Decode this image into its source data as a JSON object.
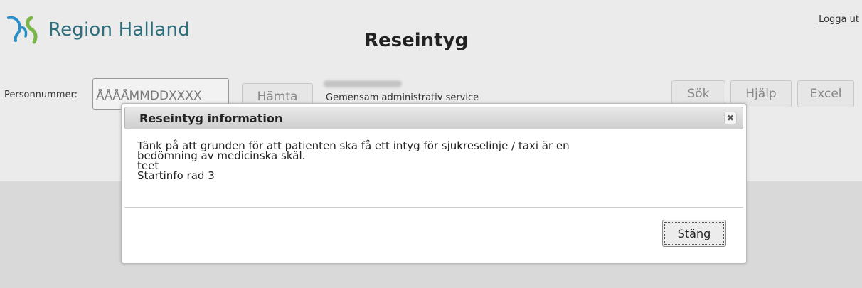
{
  "header": {
    "logo_text": "Region Halland",
    "page_title": "Reseintyg",
    "logout_label": "Logga ut"
  },
  "toolbar": {
    "personnummer_label": "Personnummer:",
    "personnummer_placeholder": "ÅÅÅÅMMDDXXXX",
    "hamta_label": "Hämta",
    "organization_text": "Gemensam administrativ service",
    "sok_label": "Sök",
    "hjalp_label": "Hjälp",
    "excel_label": "Excel"
  },
  "dialog": {
    "title": "Reseintyg information",
    "close_glyph": "✖",
    "lines": [
      "Tänk på att grunden för att patienten ska få ett intyg för sjukreselinje / taxi är en",
      "bedömning av medicinska skäl.",
      "teet",
      "Startinfo rad 3"
    ],
    "close_button_label": "Stäng"
  },
  "colors": {
    "logo_text": "#2f6f7d",
    "logo_green": "#7ab648",
    "logo_blue": "#2a8fc9",
    "background": "#ebebeb"
  }
}
